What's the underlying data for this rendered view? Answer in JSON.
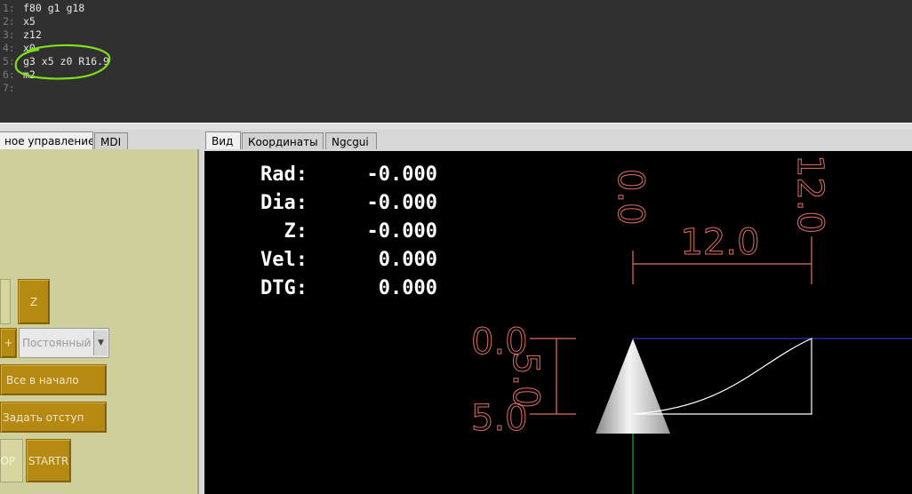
{
  "editor": {
    "lines": [
      {
        "num": "1:",
        "code": "f80 g1 g18"
      },
      {
        "num": "2:",
        "code": "x5"
      },
      {
        "num": "3:",
        "code": "z12"
      },
      {
        "num": "4:",
        "code": "x0"
      },
      {
        "num": "5:",
        "code": "g3 x5 z0 R16.9"
      },
      {
        "num": "6:",
        "code": "m2"
      },
      {
        "num": "7:",
        "code": ""
      }
    ],
    "highlight_color": "#7ee01c"
  },
  "left_panel": {
    "tabs": [
      {
        "label": "ное управление",
        "active": true
      },
      {
        "label": "MDI",
        "active": false
      }
    ],
    "z_button": "Z",
    "plus_button": "+",
    "combo_value": "Постоянный",
    "home_all_button": "Все в начало",
    "set_offset_button": "Задать отступ",
    "stop_button": "OP",
    "start_button": "STARTR",
    "panel_color": "#cfcf9c",
    "button_color": "#b58a12"
  },
  "right_panel": {
    "tabs": [
      {
        "label": "Вид",
        "active": true
      },
      {
        "label": "Координаты",
        "active": false
      },
      {
        "label": "Ngcgui",
        "active": false
      }
    ]
  },
  "dro": [
    {
      "label": "Rad:",
      "value": "-0.000"
    },
    {
      "label": "Dia:",
      "value": "-0.000"
    },
    {
      "label": "Z:",
      "value": "-0.000"
    },
    {
      "label": "Vel:",
      "value": "0.000"
    },
    {
      "label": "DTG:",
      "value": "0.000"
    }
  ],
  "preview": {
    "dim_z_start": "0.0",
    "dim_z_end": "12.0",
    "dim_z_length": "12.0",
    "dim_x_start": "0.0",
    "dim_x_end": "5.0",
    "dim_x_length": "5.0",
    "dimension_color": "#e07060",
    "toolpath_color": "#ffffff",
    "rapid_color": "#3a3aff",
    "axis_color": "#22cc44"
  }
}
